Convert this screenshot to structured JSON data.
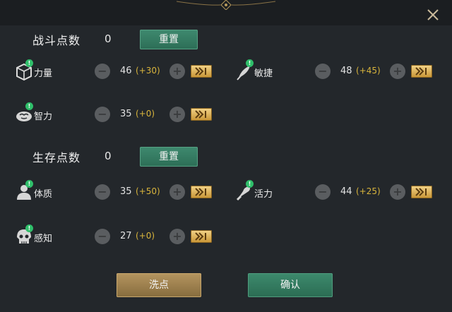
{
  "header": {
    "close_icon": "close-icon"
  },
  "combat": {
    "title": "战斗点数",
    "points": "0",
    "reset_label": "重置",
    "stats": [
      {
        "name": "力量",
        "value": "46",
        "bonus": "(+30)",
        "icon": "strength-cube-icon"
      },
      {
        "name": "敏捷",
        "value": "48",
        "bonus": "(+45)",
        "icon": "agility-feather-icon"
      },
      {
        "name": "智力",
        "value": "35",
        "bonus": "(+0)",
        "icon": "intellect-brain-icon"
      }
    ]
  },
  "survival": {
    "title": "生存点数",
    "points": "0",
    "reset_label": "重置",
    "stats": [
      {
        "name": "体质",
        "value": "35",
        "bonus": "(+50)",
        "icon": "constitution-body-icon"
      },
      {
        "name": "活力",
        "value": "44",
        "bonus": "(+25)",
        "icon": "vitality-arm-icon"
      },
      {
        "name": "感知",
        "value": "27",
        "bonus": "(+0)",
        "icon": "perception-skull-icon"
      }
    ]
  },
  "footer": {
    "wash_label": "洗点",
    "confirm_label": "确认"
  },
  "colors": {
    "accent_green": "#2f7a5f",
    "accent_gold": "#c79434",
    "bonus_text": "#d8b43c",
    "badge_green": "#2fbf6a"
  }
}
